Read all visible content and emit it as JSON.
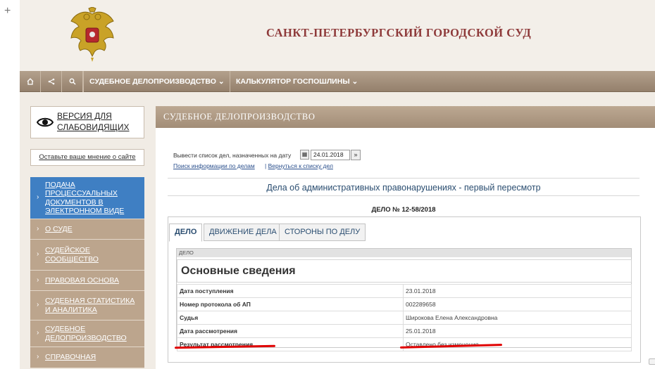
{
  "header": {
    "court_title": "САНКТ-ПЕТЕРБУРГСКИЙ ГОРОДСКОЙ СУД"
  },
  "navbar": {
    "icons": [
      "home-icon",
      "sitemap-icon",
      "search-icon"
    ],
    "items": [
      {
        "label": "СУДЕБНОЕ ДЕЛОПРОИЗВОДСТВО ⌄"
      },
      {
        "label": "КАЛЬКУЛЯТОР ГОСПОШЛИНЫ ⌄"
      }
    ]
  },
  "sidebar": {
    "vision_label": "ВЕРСИЯ ДЛЯ СЛАБОВИДЯЩИХ",
    "opinion_link": "Оставьте ваше мнение о сайте",
    "chevron": "›",
    "items": [
      {
        "label": "ПОДАЧА ПРОЦЕССУАЛЬНЫХ ДОКУМЕНТОВ В ЭЛЕКТРОННОМ ВИДЕ",
        "active": true
      },
      {
        "label": "О СУДЕ"
      },
      {
        "label": "СУДЕЙСКОЕ СООБЩЕСТВО"
      },
      {
        "label": "ПРАВОВАЯ ОСНОВА"
      },
      {
        "label": "СУДЕБНАЯ СТАТИСТИКА И АНАЛИТИКА"
      },
      {
        "label": "СУДЕБНОЕ ДЕЛОПРОИЗВОДСТВО"
      },
      {
        "label": "СПРАВОЧНАЯ"
      }
    ]
  },
  "content": {
    "section_title": "СУДЕБНОЕ ДЕЛОПРОИЗВОДСТВО",
    "date_label": "Вывести список дел, назначенных на дату",
    "calendar_glyph": "▦",
    "date_value": "24.01.2018",
    "go_glyph": "»",
    "search_link": "Поиск информации по делам",
    "back_separator": "|",
    "back_link": "Вернуться к списку дел",
    "case_type": "Дела об административных правонарушениях - первый пересмотр",
    "case_number": "ДЕЛО № 12-58/2018",
    "tabs": [
      {
        "label": "ДЕЛО",
        "active": true
      },
      {
        "label": "ДВИЖЕНИЕ ДЕЛА"
      },
      {
        "label": "СТОРОНЫ ПО ДЕЛУ"
      }
    ],
    "panel_caption": "ДЕЛО",
    "panel_title": "Основные сведения",
    "rows": [
      {
        "key": "Дата поступления",
        "value": "23.01.2018"
      },
      {
        "key": "Номер протокола об АП",
        "value": "002289658"
      },
      {
        "key": "Судья",
        "value": "Широкова Елена Александровна"
      },
      {
        "key": "Дата рассмотрения",
        "value": "25.01.2018"
      },
      {
        "key": "Результат рассмотрения",
        "value": "Оставлено без изменения"
      }
    ]
  },
  "colors": {
    "title_red": "#8e3a3a",
    "nav_brown": "#a18d78",
    "active_blue": "#3f7fc3",
    "annotation_red": "#e00000"
  }
}
